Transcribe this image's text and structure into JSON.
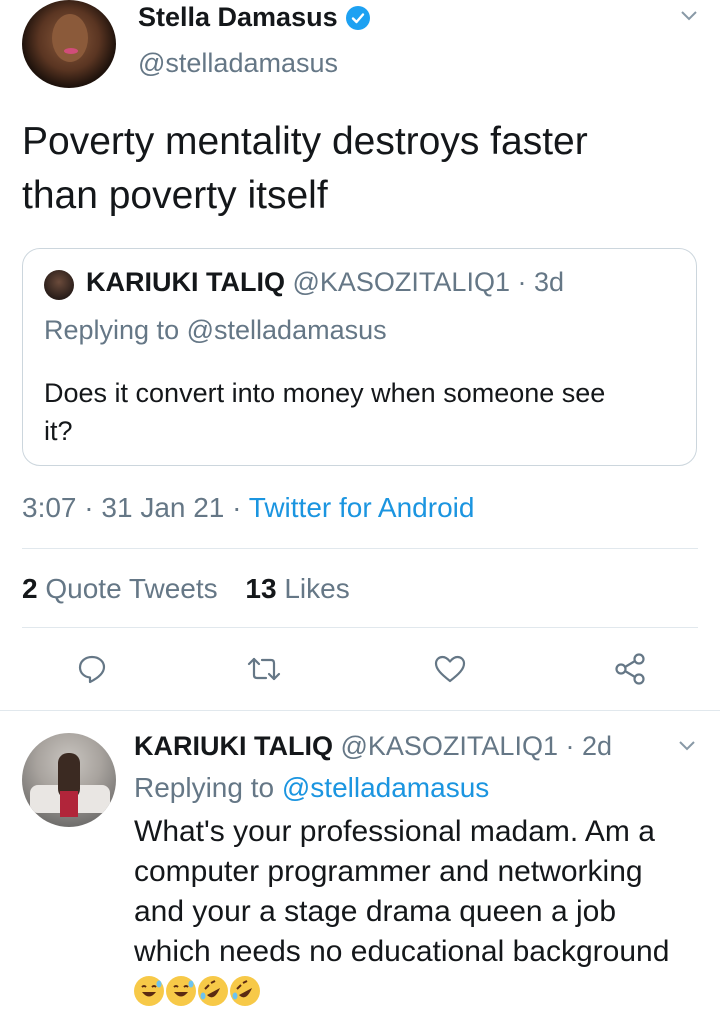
{
  "tweet": {
    "author_name": "Stella Damasus",
    "author_handle": "@stelladamasus",
    "text_line1": "Poverty mentality destroys faster",
    "text_line2": "than poverty itself",
    "time": "3:07",
    "date": "31 Jan 21",
    "source": "Twitter for Android",
    "quote_count": "2",
    "quote_label": "Quote Tweets",
    "like_count": "13",
    "like_label": "Likes"
  },
  "quoted": {
    "author_name": "KARIUKI TALIQ",
    "author_handle": "@KASOZITALIQ1",
    "age": "3d",
    "replying_prefix": "Replying to",
    "replying_handle": "@stelladamasus",
    "text_line1": "Does it convert into money when someone see",
    "text_line2": "it?"
  },
  "reply": {
    "author_name": "KARIUKI TALIQ",
    "author_handle": "@KASOZITALIQ1",
    "age": "2d",
    "replying_prefix": "Replying to",
    "replying_handle": "@stelladamasus",
    "lines": [
      "What's your professional madam. Am a",
      "computer programmer and networking",
      "and your a stage drama queen a job",
      "which needs no educational background"
    ],
    "emojis": [
      "grinning-sweat-face",
      "grinning-sweat-face",
      "rolling-on-floor-laughing",
      "rolling-on-floor-laughing"
    ]
  },
  "colors": {
    "accent": "#1b95e0",
    "verified": "#1da1f2",
    "muted": "#657786",
    "icon": "#657786"
  }
}
